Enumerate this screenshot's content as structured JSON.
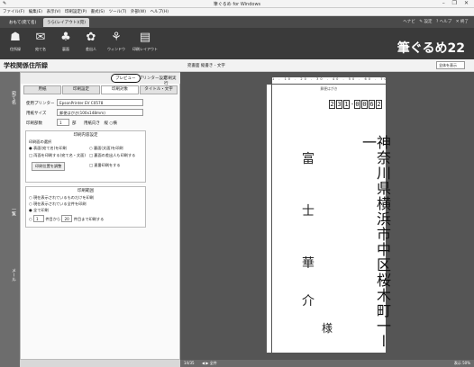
{
  "window": {
    "title": "筆ぐるめ for Windows",
    "controls": "– ❐ ✕"
  },
  "menu": [
    "ファイル(F)",
    "編集(E)",
    "表示(V)",
    "印刷設定(P)",
    "書式(S)",
    "ツール(T)",
    "外部(W)",
    "ヘルプ(H)"
  ],
  "ribbon_tabs": [
    "おもて(宛て名)",
    "うら(レイアウト)(宛)"
  ],
  "ribbon_right": "ヘナビ　✎ 設定　? ヘルプ　✕ 終了",
  "tools": [
    {
      "label": "住所録",
      "icon": "☗"
    },
    {
      "label": "宛て名",
      "icon": "✉"
    },
    {
      "label": "裏面",
      "icon": "♣"
    },
    {
      "label": "差出人",
      "icon": "✿"
    },
    {
      "label": "ウィンドウ",
      "icon": "⚘"
    },
    {
      "label": "印刷レイアウト",
      "icon": "▤"
    }
  ],
  "brand": "筆ぐるめ22",
  "page_title": "学校関係住所録",
  "preview_header": "宛書面 縦書き - 文字",
  "view_select": "全体を表示",
  "rail_tabs": [
    "宛て名",
    "一覧",
    "メール"
  ],
  "panel_tabs": {
    "preview": "プレビュー",
    "printer": "プリンター設定",
    "print_run": "印刷実行"
  },
  "sub_tabs": [
    "用紙",
    "印刷設定",
    "印刷対象",
    "タイトル・文字"
  ],
  "printer_label": "使用プリンター",
  "printer_value": "EpsonPrinter EV C0578",
  "paper_label": "用紙サイズ",
  "paper_value": "郵便はがき(100x148mm)",
  "copies_label": "印刷部数",
  "copies_value": "1",
  "copies_unit": "部",
  "copies_extra": "用紙向き　縦 ○横",
  "group1": {
    "title": "印刷内容設定",
    "subtitle": "印刷面の選択",
    "options": [
      "表面(宛て名)を印刷",
      "裏面(文面)を印刷",
      "両面を印刷する(宛て名・文面)",
      "裏面の差出人も印刷する"
    ],
    "btn1": "印刷位置を調整",
    "btn2": "□ 連番印刷をする"
  },
  "group2": {
    "title": "印刷範囲",
    "options": [
      "現在表示されているものだけを印刷",
      "現在表示されている全件を印刷",
      "全て印刷",
      "番号指定"
    ],
    "from": "1",
    "from_label": "件目から",
    "to": "20",
    "to_label": "件目まで印刷する"
  },
  "card": {
    "label": "郵便はがき",
    "zip": [
      "2",
      "3",
      "1",
      "0",
      "0",
      "6",
      "2"
    ],
    "address": "神奈川県横浜市中区桜木町一ー一",
    "name": [
      "富",
      "士",
      "華",
      "介"
    ],
    "honorific": "様"
  },
  "ruler": "1 . 10 . 20 . 30 . 40 . 50 . 60 . 70 . 80 . 90 . 100",
  "status": {
    "page": "14/35",
    "nav": "◀ ▶ 全件",
    "right": "表示 50%"
  }
}
